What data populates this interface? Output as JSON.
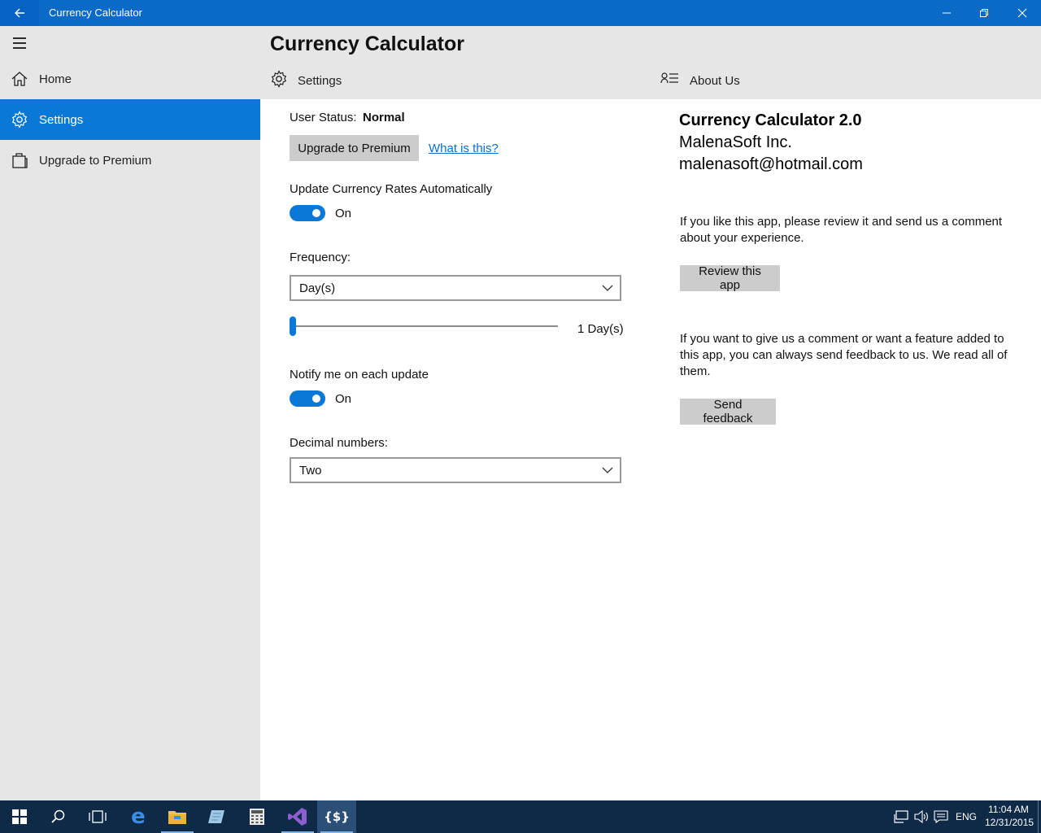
{
  "window": {
    "title": "Currency Calculator"
  },
  "sidebar": {
    "items": [
      {
        "label": "Home",
        "icon": "home-icon"
      },
      {
        "label": "Settings",
        "icon": "gear-icon",
        "active": true
      },
      {
        "label": "Upgrade to Premium",
        "icon": "shopping-bag-icon"
      }
    ]
  },
  "header": {
    "title": "Currency Calculator",
    "settings_label": "Settings",
    "about_label": "About Us"
  },
  "settings": {
    "user_status_label": "User Status:",
    "user_status_value": "Normal",
    "upgrade_button": "Upgrade to Premium",
    "what_is_this_link": "What is this?",
    "auto_update_label": "Update Currency Rates Automatically",
    "auto_update_state": "On",
    "frequency_label": "Frequency:",
    "frequency_value": "Day(s)",
    "frequency_slider_value": "1 Day(s)",
    "notify_label": "Notify me on each update",
    "notify_state": "On",
    "decimal_label": "Decimal numbers:",
    "decimal_value": "Two"
  },
  "about": {
    "app_name": "Currency Calculator 2.0",
    "company": "MalenaSoft Inc.",
    "email": "malenasoft@hotmail.com",
    "review_text": "If you like this app, please review it and send us a comment about your experience.",
    "review_button": "Review this app",
    "feedback_text": "If you want to give us a comment or want a feature added to this app, you can always send feedback to us. We read all of them.",
    "feedback_button": "Send feedback"
  },
  "taskbar": {
    "language": "ENG",
    "time": "11:04 AM",
    "date": "12/31/2015"
  },
  "colors": {
    "accent": "#0a78d7",
    "titlebar": "#0a6ac8",
    "pane": "#e6e6e6",
    "taskbar": "#0e2a47"
  }
}
